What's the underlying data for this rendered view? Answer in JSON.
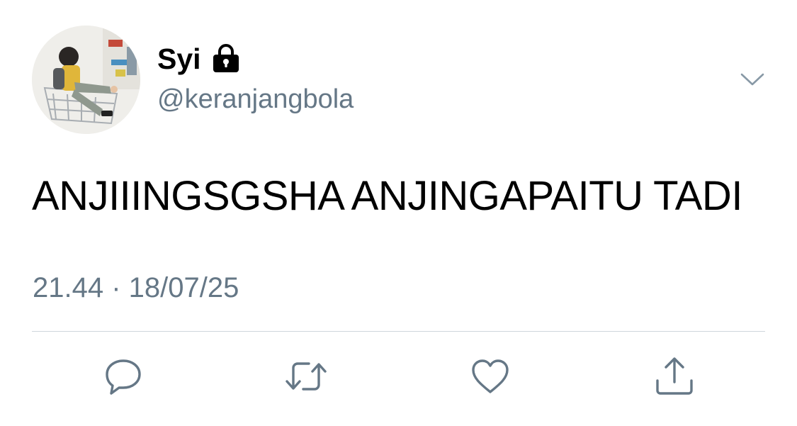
{
  "user": {
    "display_name": "Syi",
    "handle": "@keranjangbola",
    "avatar_icon": "user-avatar-photo",
    "lock_icon": "lock-icon"
  },
  "tweet": {
    "text": "ANJIIINGSGSHA ANJINGAPAITU TADI",
    "timestamp": "21.44 · 18/07/25"
  },
  "actions": [
    {
      "icon": "reply-icon"
    },
    {
      "icon": "retweet-icon"
    },
    {
      "icon": "like-icon"
    },
    {
      "icon": "share-icon"
    }
  ],
  "colors": {
    "text": "#000000",
    "secondary": "#657786",
    "icon": "#657786",
    "divider": "#cfd6dc",
    "background": "#ffffff"
  }
}
